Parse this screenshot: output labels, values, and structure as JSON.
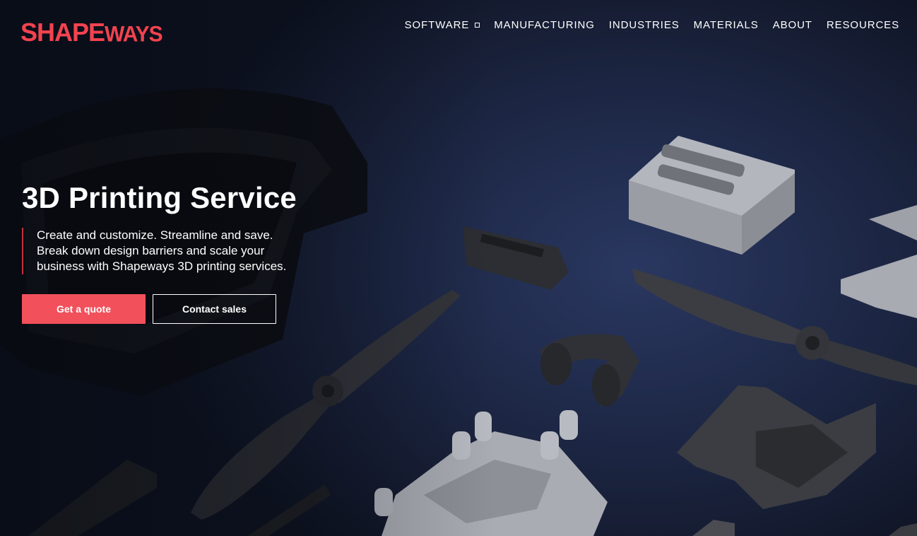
{
  "brand": {
    "logo_bold": "SHAPE",
    "logo_light": "WAYS",
    "accent_color": "#f2434f"
  },
  "nav": {
    "items": [
      {
        "label": "SOFTWARE",
        "has_dropdown": true
      },
      {
        "label": "MANUFACTURING"
      },
      {
        "label": "INDUSTRIES"
      },
      {
        "label": "MATERIALS"
      },
      {
        "label": "ABOUT"
      },
      {
        "label": "RESOURCES"
      }
    ]
  },
  "hero": {
    "title": "3D Printing Service",
    "description": "Create and customize. Streamline and save.\nBreak down design barriers and scale your\nbusiness with Shapeways 3D printing services.",
    "primary_button": "Get a quote",
    "secondary_button": "Contact sales"
  },
  "colors": {
    "button_primary": "#f2505b",
    "background": "#1f2a4a"
  }
}
